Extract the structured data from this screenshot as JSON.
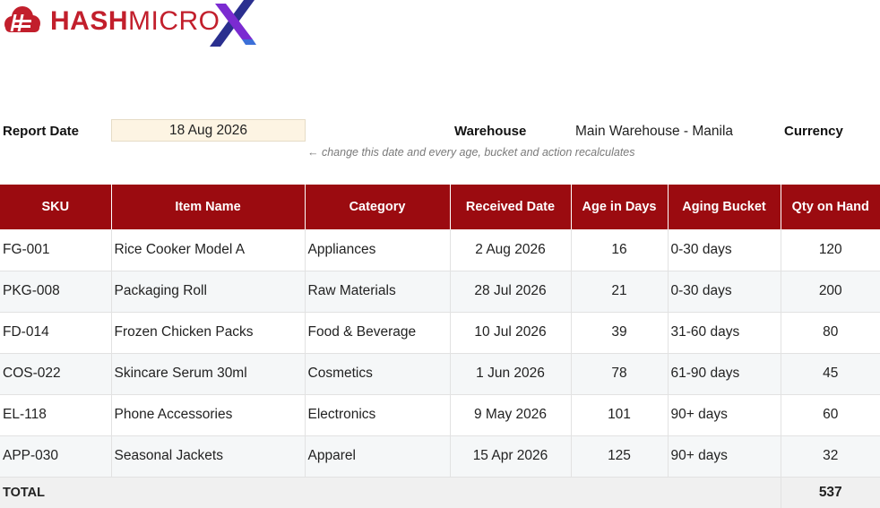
{
  "brand": {
    "name_bold": "HASH",
    "name_regular": "MICRO",
    "colors": {
      "red": "#c21f2c",
      "blue": "#2a2f8f",
      "purple": "#7b2bd1"
    }
  },
  "meta": {
    "report_date_label": "Report Date",
    "report_date_value": "18 Aug 2026",
    "warehouse_label": "Warehouse",
    "warehouse_value": "Main Warehouse - Manila",
    "currency_label": "Currency",
    "hint": "← change this date and every age, bucket and action recalculates"
  },
  "table": {
    "header_color": "#9b0b10",
    "columns": [
      "SKU",
      "Item Name",
      "Category",
      "Received Date",
      "Age in Days",
      "Aging Bucket",
      "Qty on Hand"
    ],
    "rows": [
      {
        "sku": "FG-001",
        "item": "Rice Cooker Model A",
        "category": "Appliances",
        "received": "2 Aug 2026",
        "age": "16",
        "bucket": "0-30 days",
        "qty": "120"
      },
      {
        "sku": "PKG-008",
        "item": "Packaging Roll",
        "category": "Raw Materials",
        "received": "28 Jul 2026",
        "age": "21",
        "bucket": "0-30 days",
        "qty": "200"
      },
      {
        "sku": "FD-014",
        "item": "Frozen Chicken Packs",
        "category": "Food & Beverage",
        "received": "10 Jul 2026",
        "age": "39",
        "bucket": "31-60 days",
        "qty": "80"
      },
      {
        "sku": "COS-022",
        "item": "Skincare Serum 30ml",
        "category": "Cosmetics",
        "received": "1 Jun 2026",
        "age": "78",
        "bucket": "61-90 days",
        "qty": "45"
      },
      {
        "sku": "EL-118",
        "item": "Phone Accessories",
        "category": "Electronics",
        "received": "9 May 2026",
        "age": "101",
        "bucket": "90+ days",
        "qty": "60"
      },
      {
        "sku": "APP-030",
        "item": "Seasonal Jackets",
        "category": "Apparel",
        "received": "15 Apr 2026",
        "age": "125",
        "bucket": "90+ days",
        "qty": "32"
      }
    ],
    "total_label": "TOTAL",
    "total_qty": "537"
  }
}
